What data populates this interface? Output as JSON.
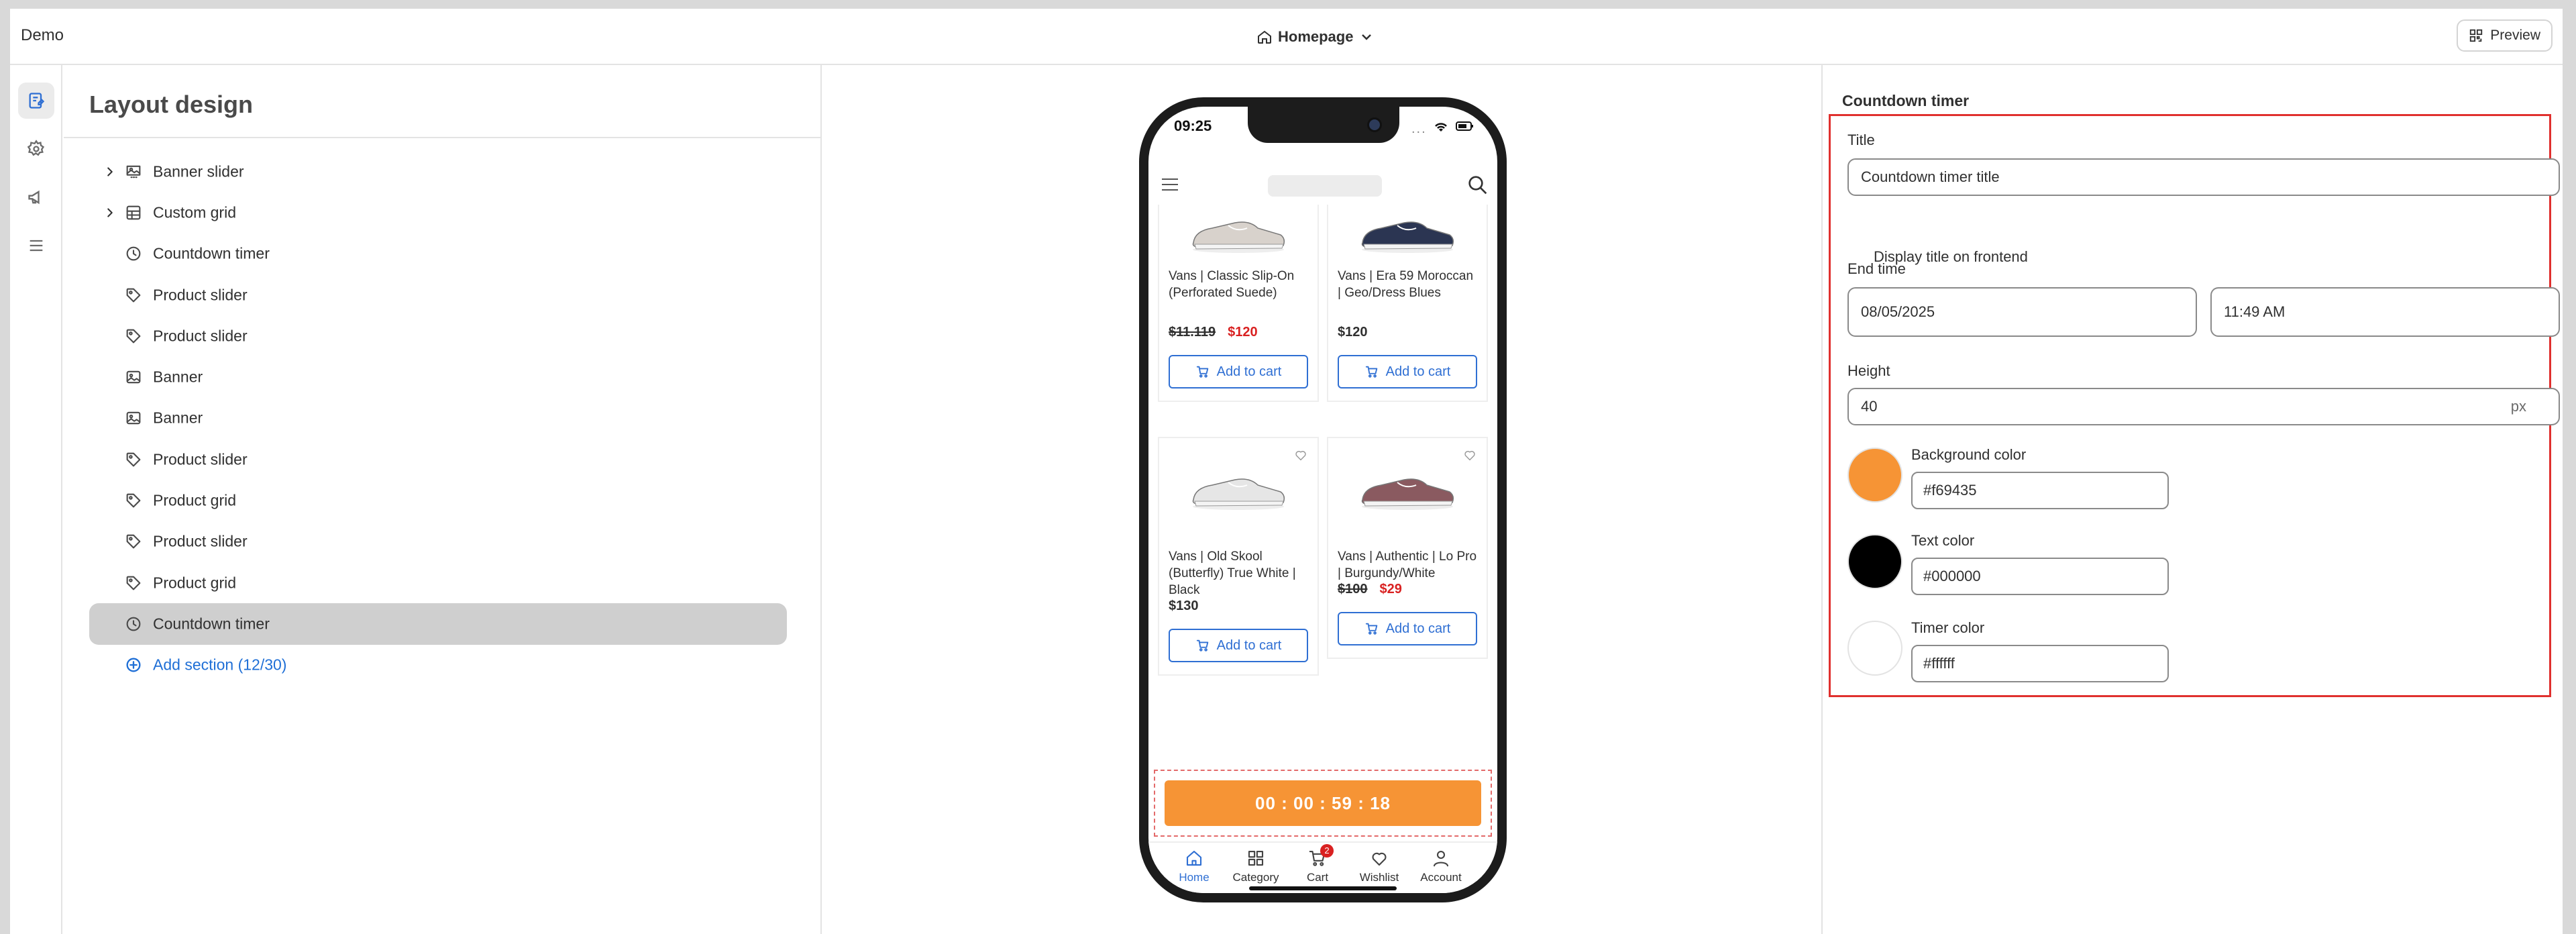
{
  "topbar": {
    "app_name": "Demo",
    "page_selector": "Homepage",
    "preview_label": "Preview"
  },
  "rail": {
    "icons": [
      "layout-icon",
      "gear-icon",
      "megaphone-icon",
      "list-icon"
    ]
  },
  "sidebar": {
    "title": "Layout design",
    "sections": [
      {
        "label": "Banner slider",
        "icon": "banner-slider-icon",
        "expandable": true
      },
      {
        "label": "Custom grid",
        "icon": "grid-icon",
        "expandable": true
      },
      {
        "label": "Countdown timer",
        "icon": "clock-icon",
        "expandable": false
      },
      {
        "label": "Product slider",
        "icon": "tag-icon",
        "expandable": false
      },
      {
        "label": "Product slider",
        "icon": "tag-icon",
        "expandable": false
      },
      {
        "label": "Banner",
        "icon": "image-icon",
        "expandable": false
      },
      {
        "label": "Banner",
        "icon": "image-icon",
        "expandable": false
      },
      {
        "label": "Product slider",
        "icon": "tag-icon",
        "expandable": false
      },
      {
        "label": "Product grid",
        "icon": "tag-icon",
        "expandable": false
      },
      {
        "label": "Product slider",
        "icon": "tag-icon",
        "expandable": false
      },
      {
        "label": "Product grid",
        "icon": "tag-icon",
        "expandable": false
      },
      {
        "label": "Countdown timer",
        "icon": "clock-icon",
        "expandable": false,
        "selected": true
      }
    ],
    "add_section_label": "Add section (12/30)"
  },
  "phone": {
    "status_time": "09:25",
    "products": [
      {
        "name": "Vans | Classic Slip-On (Perforated Suede)",
        "old_price": "$11.119",
        "price": "$120",
        "sale": true,
        "cart_label": "Add to cart",
        "shoe_color": "#d8d2cc"
      },
      {
        "name": "Vans | Era 59 Moroccan | Geo/Dress Blues",
        "old_price": "",
        "price": "$120",
        "sale": false,
        "cart_label": "Add to cart",
        "shoe_color": "#2b3552"
      },
      {
        "name": "Vans | Old Skool (Butterfly) True White | Black",
        "old_price": "",
        "price": "$130",
        "sale": false,
        "cart_label": "Add to cart",
        "shoe_color": "#e6e6e6"
      },
      {
        "name": "Vans | Authentic | Lo Pro | Burgundy/White",
        "old_price": "$100",
        "price": "$29",
        "sale": true,
        "cart_label": "Add to cart",
        "shoe_color": "#8a5a60"
      }
    ],
    "timer_text": "00 : 00 : 59 : 18",
    "nav": [
      {
        "label": "Home",
        "icon": "home-icon",
        "active": true
      },
      {
        "label": "Category",
        "icon": "category-icon",
        "active": false
      },
      {
        "label": "Cart",
        "icon": "cart-icon",
        "active": false,
        "badge": "2"
      },
      {
        "label": "Wishlist",
        "icon": "heart-icon",
        "active": false
      },
      {
        "label": "Account",
        "icon": "user-icon",
        "active": false
      }
    ]
  },
  "settings": {
    "panel_title": "Countdown timer",
    "title_label": "Title",
    "title_value": "Countdown timer title",
    "display_title_label": "Display title on frontend",
    "display_title_checked": false,
    "end_time_label": "End time",
    "end_date": "08/05/2025",
    "end_time": "11:49 AM",
    "height_label": "Height",
    "height_value": "40",
    "height_unit": "px",
    "background_color_label": "Background color",
    "background_color": "#f69435",
    "text_color_label": "Text color",
    "text_color": "#000000",
    "timer_color_label": "Timer color",
    "timer_color": "#ffffff"
  },
  "colors": {
    "accent_blue": "#2f6fd3",
    "sale_red": "#d92121",
    "highlight_red": "#e0302e"
  }
}
